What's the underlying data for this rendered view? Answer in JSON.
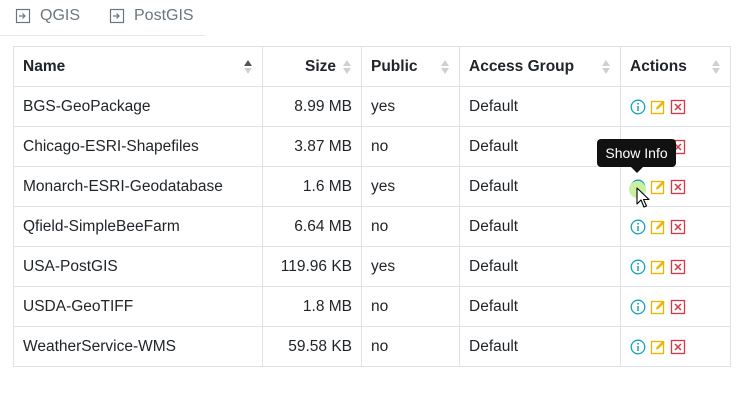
{
  "tabs": [
    {
      "label": "QGIS",
      "icon": "sign-in-icon"
    },
    {
      "label": "PostGIS",
      "icon": "sign-in-icon"
    }
  ],
  "table": {
    "headers": [
      "Name",
      "Size",
      "Public",
      "Access Group",
      "Actions"
    ],
    "rows": [
      {
        "name": "BGS-GeoPackage",
        "size": "8.99 MB",
        "public": "yes",
        "group": "Default"
      },
      {
        "name": "Chicago-ESRI-Shapefiles",
        "size": "3.87 MB",
        "public": "no",
        "group": "Default"
      },
      {
        "name": "Monarch-ESRI-Geodatabase",
        "size": "1.6 MB",
        "public": "yes",
        "group": "Default"
      },
      {
        "name": "Qfield-SimpleBeeFarm",
        "size": "6.64 MB",
        "public": "no",
        "group": "Default"
      },
      {
        "name": "USA-PostGIS",
        "size": "119.96 KB",
        "public": "yes",
        "group": "Default"
      },
      {
        "name": "USDA-GeoTIFF",
        "size": "1.8 MB",
        "public": "no",
        "group": "Default"
      },
      {
        "name": "WeatherService-WMS",
        "size": "59.58 KB",
        "public": "no",
        "group": "Default"
      }
    ]
  },
  "tooltip": {
    "text": "Show Info"
  },
  "colors": {
    "info": "#17a2b8",
    "edit": "#f0b400",
    "delete": "#dc3545"
  }
}
